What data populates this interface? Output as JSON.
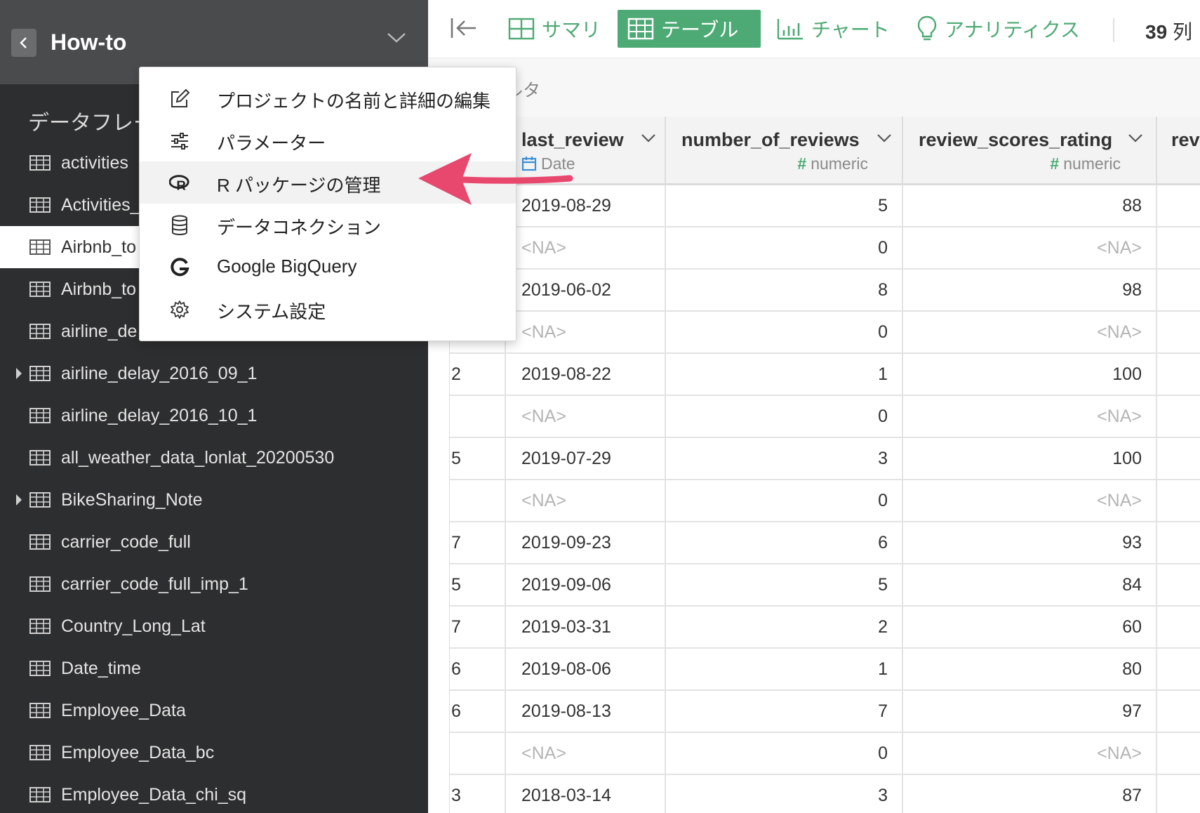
{
  "sidebar": {
    "project_title": "How-to",
    "section_title": "データフレーム",
    "items": [
      {
        "label": "activities",
        "expandable": false,
        "active": false
      },
      {
        "label": "Activities_",
        "expandable": false,
        "active": false
      },
      {
        "label": "Airbnb_to",
        "expandable": false,
        "active": true
      },
      {
        "label": "Airbnb_to",
        "expandable": false,
        "active": false
      },
      {
        "label": "airline_de",
        "expandable": false,
        "active": false
      },
      {
        "label": "airline_delay_2016_09_1",
        "expandable": true,
        "active": false
      },
      {
        "label": "airline_delay_2016_10_1",
        "expandable": false,
        "active": false
      },
      {
        "label": "all_weather_data_lonlat_20200530",
        "expandable": false,
        "active": false
      },
      {
        "label": "BikeSharing_Note",
        "expandable": true,
        "active": false
      },
      {
        "label": "carrier_code_full",
        "expandable": false,
        "active": false
      },
      {
        "label": "carrier_code_full_imp_1",
        "expandable": false,
        "active": false
      },
      {
        "label": "Country_Long_Lat",
        "expandable": false,
        "active": false
      },
      {
        "label": "Date_time",
        "expandable": false,
        "active": false
      },
      {
        "label": "Employee_Data",
        "expandable": false,
        "active": false
      },
      {
        "label": "Employee_Data_bc",
        "expandable": false,
        "active": false
      },
      {
        "label": "Employee_Data_chi_sq",
        "expandable": false,
        "active": false
      }
    ]
  },
  "toolbar": {
    "tabs": [
      {
        "label": "サマリ",
        "icon": "summary-grid-icon",
        "active": false
      },
      {
        "label": "テーブル",
        "icon": "table-icon",
        "active": true
      },
      {
        "label": "チャート",
        "icon": "bar-chart-icon",
        "active": false
      },
      {
        "label": "アナリティクス",
        "icon": "lightbulb-icon",
        "active": false
      }
    ],
    "column_count": "39",
    "column_unit": "列"
  },
  "filter": {
    "label": "ルタ"
  },
  "table": {
    "columns": [
      {
        "name": "last_review",
        "type": "Date"
      },
      {
        "name": "number_of_reviews",
        "type": "numeric"
      },
      {
        "name": "review_scores_rating",
        "type": "numeric"
      },
      {
        "name": "rev",
        "type": ""
      }
    ],
    "rows": [
      {
        "idx": "",
        "last_review": "2019-08-29",
        "number_of_reviews": "5",
        "review_scores_rating": "88"
      },
      {
        "idx": "",
        "last_review": "<NA>",
        "number_of_reviews": "0",
        "review_scores_rating": "<NA>"
      },
      {
        "idx": "",
        "last_review": "2019-06-02",
        "number_of_reviews": "8",
        "review_scores_rating": "98"
      },
      {
        "idx": "",
        "last_review": "<NA>",
        "number_of_reviews": "0",
        "review_scores_rating": "<NA>"
      },
      {
        "idx": "2",
        "last_review": "2019-08-22",
        "number_of_reviews": "1",
        "review_scores_rating": "100"
      },
      {
        "idx": "",
        "last_review": "<NA>",
        "number_of_reviews": "0",
        "review_scores_rating": "<NA>"
      },
      {
        "idx": "5",
        "last_review": "2019-07-29",
        "number_of_reviews": "3",
        "review_scores_rating": "100"
      },
      {
        "idx": "",
        "last_review": "<NA>",
        "number_of_reviews": "0",
        "review_scores_rating": "<NA>"
      },
      {
        "idx": "7",
        "last_review": "2019-09-23",
        "number_of_reviews": "6",
        "review_scores_rating": "93"
      },
      {
        "idx": "5",
        "last_review": "2019-09-06",
        "number_of_reviews": "5",
        "review_scores_rating": "84"
      },
      {
        "idx": "7",
        "last_review": "2019-03-31",
        "number_of_reviews": "2",
        "review_scores_rating": "60"
      },
      {
        "idx": "6",
        "last_review": "2019-08-06",
        "number_of_reviews": "1",
        "review_scores_rating": "80"
      },
      {
        "idx": "6",
        "last_review": "2019-08-13",
        "number_of_reviews": "7",
        "review_scores_rating": "97"
      },
      {
        "idx": "",
        "last_review": "<NA>",
        "number_of_reviews": "0",
        "review_scores_rating": "<NA>"
      },
      {
        "idx": "3",
        "last_review": "2018-03-14",
        "number_of_reviews": "3",
        "review_scores_rating": "87"
      }
    ]
  },
  "menu": {
    "items": [
      {
        "label": "プロジェクトの名前と詳細の編集",
        "icon": "edit-icon",
        "highlighted": false
      },
      {
        "label": "パラメーター",
        "icon": "sliders-icon",
        "highlighted": false
      },
      {
        "label": "R パッケージの管理",
        "icon": "r-logo-icon",
        "highlighted": true
      },
      {
        "label": "データコネクション",
        "icon": "database-icon",
        "highlighted": false
      },
      {
        "label": "Google BigQuery",
        "icon": "google-icon",
        "highlighted": false
      },
      {
        "label": "システム設定",
        "icon": "gear-icon",
        "highlighted": false
      }
    ]
  },
  "colors": {
    "accent_green": "#4daa74",
    "sidebar_bg": "#2d2e2f",
    "sidebar_header_bg": "#4a4b4d",
    "arrow_pink": "#e8476e",
    "na_text": "#b5b5b5"
  }
}
